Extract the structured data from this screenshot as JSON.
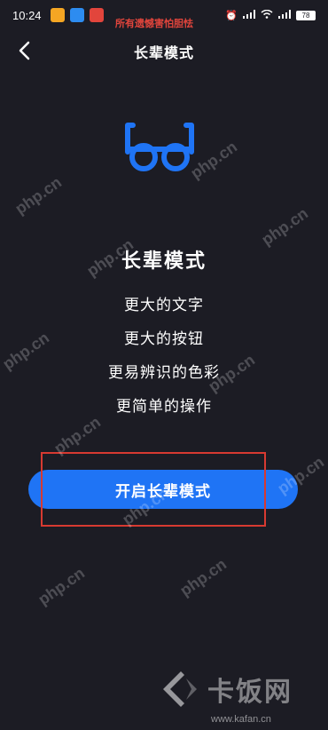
{
  "status": {
    "time": "10:24",
    "battery": "78"
  },
  "overlay_caption": "所有遗憾害怕胆怯",
  "nav": {
    "title": "长辈模式"
  },
  "main": {
    "heading": "长辈模式",
    "features": [
      "更大的文字",
      "更大的按钮",
      "更易辨识的色彩",
      "更简单的操作"
    ],
    "cta_label": "开启长辈模式"
  },
  "watermarks": {
    "text": "php.cn"
  },
  "brand": {
    "name": "卡饭网",
    "url": "www.kafan.cn"
  },
  "colors": {
    "accent": "#1f74f5",
    "background": "#1c1c24",
    "highlight": "#d73a31"
  }
}
